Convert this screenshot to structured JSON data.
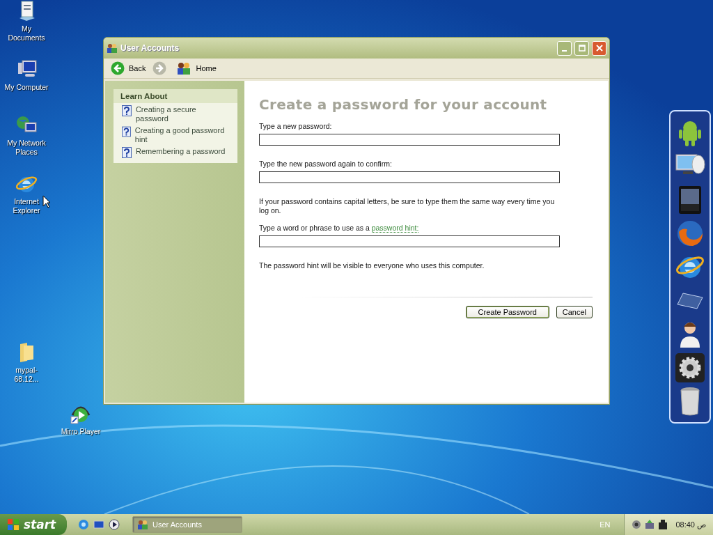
{
  "desktop_icons": [
    {
      "label": "My Documents",
      "kind": "documents"
    },
    {
      "label": "My Computer",
      "kind": "computer"
    },
    {
      "label": "My Network Places",
      "kind": "network"
    },
    {
      "label": "Internet Explorer",
      "kind": "browser"
    },
    {
      "label": "mypal-68.12...",
      "kind": "folder"
    },
    {
      "label": "Mirro Player",
      "kind": "player"
    }
  ],
  "window": {
    "title": "User Accounts",
    "back": "Back",
    "home": "Home"
  },
  "learn_about": {
    "title": "Learn About",
    "links": [
      "Creating a secure password",
      "Creating a good password hint",
      "Remembering a password"
    ]
  },
  "form": {
    "heading": "Create a password for your account",
    "new_password_label": "Type a new password:",
    "confirm_label": "Type the new password again to confirm:",
    "caps_note": "If your password contains capital letters, be sure to type them the same way every time you log on.",
    "hint_label": "Type a word or phrase to use as a",
    "hint_link": "password hint:",
    "hint_note": "The password hint will be visible to everyone who uses this computer.",
    "buttons": [
      "Create Password",
      "Cancel"
    ]
  },
  "taskbar": {
    "start": "start",
    "tasks": [
      {
        "label": "User Accounts",
        "selected": true
      }
    ],
    "language": "EN",
    "clock": "08:40 ص"
  }
}
